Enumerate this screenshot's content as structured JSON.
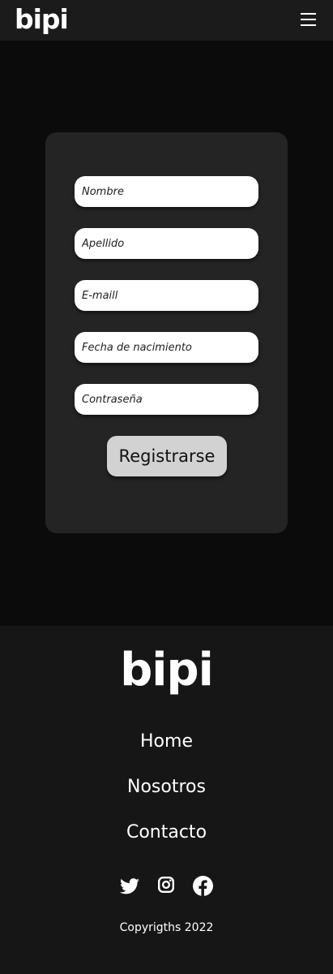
{
  "header": {
    "logo": "bipi",
    "menu_icon": "hamburger-icon"
  },
  "form": {
    "fields": {
      "nombre": {
        "placeholder": "Nombre"
      },
      "apellido": {
        "placeholder": "Apellido"
      },
      "email": {
        "placeholder": "E-maill"
      },
      "fecha": {
        "placeholder": "Fecha de nacimiento"
      },
      "password": {
        "placeholder": "Contraseña"
      }
    },
    "submit_label": "Registrarse"
  },
  "footer": {
    "logo": "bipi",
    "nav": {
      "home": "Home",
      "nosotros": "Nosotros",
      "contacto": "Contacto"
    },
    "social_icons": [
      "twitter-icon",
      "instagram-icon",
      "facebook-icon"
    ],
    "copyright": "Copyrigths 2022"
  },
  "colors": {
    "header_bg": "#1b1b1b",
    "page_bg": "#0b0b0b",
    "card_bg": "#242424",
    "footer_bg": "#161616",
    "button_bg": "#d2d2d2"
  }
}
